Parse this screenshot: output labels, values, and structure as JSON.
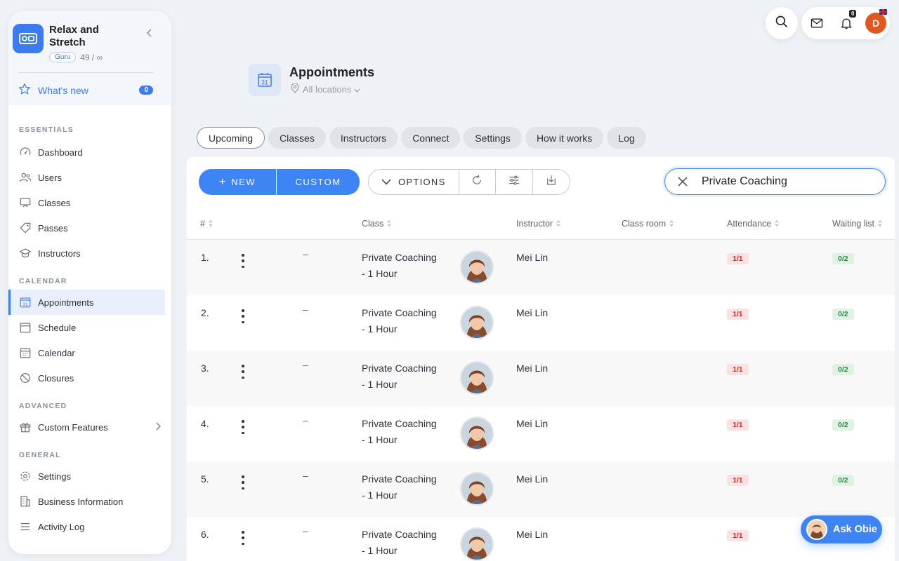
{
  "brand": {
    "name": "Relax and Stretch",
    "plan": "Guru",
    "quota": "49 / ∞"
  },
  "whats_new": {
    "label": "What's new",
    "count": "0"
  },
  "nav": {
    "essentials_title": "ESSENTIALS",
    "essentials": [
      {
        "label": "Dashboard",
        "icon": "dashboard-icon"
      },
      {
        "label": "Users",
        "icon": "users-icon"
      },
      {
        "label": "Classes",
        "icon": "classes-icon"
      },
      {
        "label": "Passes",
        "icon": "passes-icon"
      },
      {
        "label": "Instructors",
        "icon": "instructors-icon"
      }
    ],
    "calendar_title": "CALENDAR",
    "calendar": [
      {
        "label": "Appointments",
        "icon": "appointments-icon",
        "active": true
      },
      {
        "label": "Schedule",
        "icon": "schedule-icon"
      },
      {
        "label": "Calendar",
        "icon": "calendar-icon"
      },
      {
        "label": "Closures",
        "icon": "closures-icon"
      }
    ],
    "advanced_title": "ADVANCED",
    "advanced": [
      {
        "label": "Custom Features",
        "icon": "gift-icon"
      }
    ],
    "general_title": "GENERAL",
    "general": [
      {
        "label": "Settings",
        "icon": "settings-icon"
      },
      {
        "label": "Business Information",
        "icon": "building-icon"
      },
      {
        "label": "Activity Log",
        "icon": "list-icon"
      }
    ]
  },
  "topbar": {
    "notifications": "0",
    "avatar_letter": "D",
    "accent": "#e2571f"
  },
  "page": {
    "title": "Appointments",
    "location": "All locations"
  },
  "tabs": [
    "Upcoming",
    "Classes",
    "Instructors",
    "Connect",
    "Settings",
    "How it works",
    "Log"
  ],
  "toolbar": {
    "new_label": "NEW",
    "custom_label": "CUSTOM",
    "options_label": "OPTIONS"
  },
  "search": {
    "value": "Private Coaching"
  },
  "table": {
    "columns": [
      "#",
      "Class",
      "Instructor",
      "Class room",
      "Attendance",
      "Waiting list"
    ],
    "rows": [
      {
        "num": "1.",
        "dash": "–",
        "class_line1": "Private Coaching",
        "class_line2": "- 1 Hour",
        "instructor": "Mei Lin",
        "attendance": "1/1",
        "waiting": "0/2"
      },
      {
        "num": "2.",
        "dash": "–",
        "class_line1": "Private Coaching",
        "class_line2": "- 1 Hour",
        "instructor": "Mei Lin",
        "attendance": "1/1",
        "waiting": "0/2"
      },
      {
        "num": "3.",
        "dash": "–",
        "class_line1": "Private Coaching",
        "class_line2": "- 1 Hour",
        "instructor": "Mei Lin",
        "attendance": "1/1",
        "waiting": "0/2"
      },
      {
        "num": "4.",
        "dash": "–",
        "class_line1": "Private Coaching",
        "class_line2": "- 1 Hour",
        "instructor": "Mei Lin",
        "attendance": "1/1",
        "waiting": "0/2"
      },
      {
        "num": "5.",
        "dash": "–",
        "class_line1": "Private Coaching",
        "class_line2": "- 1 Hour",
        "instructor": "Mei Lin",
        "attendance": "1/1",
        "waiting": "0/2"
      },
      {
        "num": "6.",
        "dash": "–",
        "class_line1": "Private Coaching",
        "class_line2": "- 1 Hour",
        "instructor": "Mei Lin",
        "attendance": "1/1",
        "waiting": ""
      }
    ]
  },
  "assistant": {
    "label": "Ask Obie"
  },
  "colors": {
    "primary": "#3d84f5",
    "danger_bg": "#fbe2e2",
    "success_bg": "#dff2e3"
  }
}
